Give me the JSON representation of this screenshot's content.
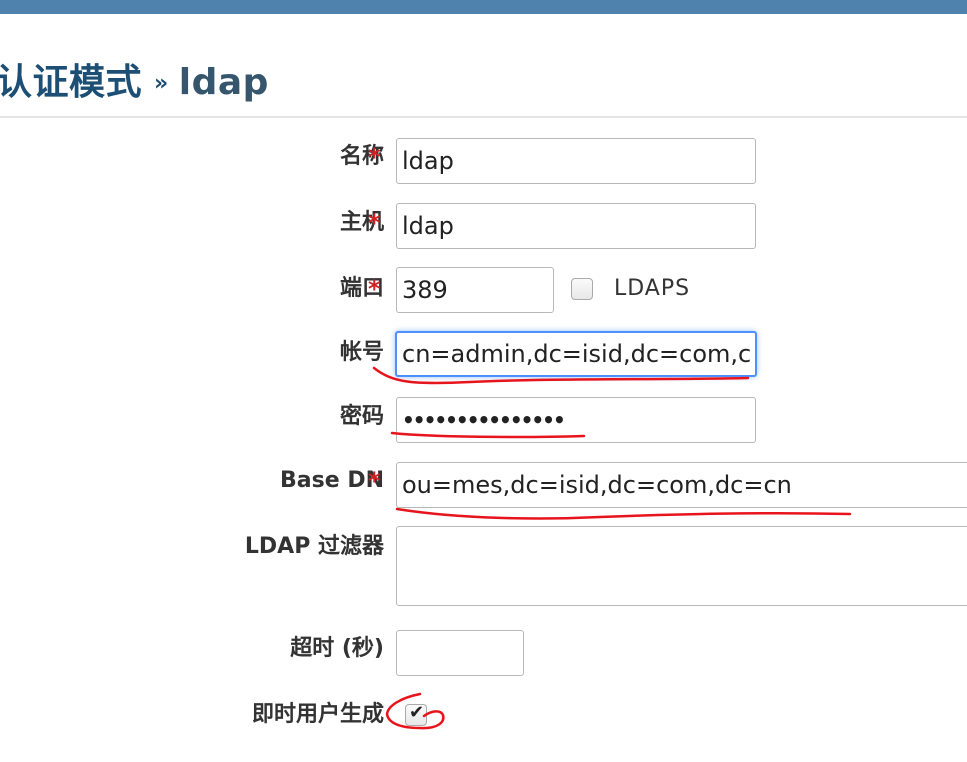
{
  "header": {
    "title": "认证模式",
    "separator": "»",
    "subtitle": "ldap"
  },
  "form": {
    "name": {
      "label": "名称",
      "required": "*",
      "value": "ldap"
    },
    "host": {
      "label": "主机",
      "required": "*",
      "value": "ldap"
    },
    "port": {
      "label": "端口",
      "required": "*",
      "value": "389",
      "ldaps_label": "LDAPS",
      "ldaps_checked": false
    },
    "account": {
      "label": "帐号",
      "value": "cn=admin,dc=isid,dc=com,c"
    },
    "password": {
      "label": "密码",
      "value": "•••••••••••••••"
    },
    "base_dn": {
      "label": "Base DN",
      "required": "*",
      "value": "ou=mes,dc=isid,dc=com,dc=cn"
    },
    "ldap_filter": {
      "label": "LDAP 过滤器",
      "value": ""
    },
    "timeout": {
      "label": "超时 (秒)",
      "value": ""
    },
    "onthefly": {
      "label": "即时用户生成",
      "checked": true,
      "checkmark": "✔"
    }
  },
  "colors": {
    "topbar": "#4f83ad",
    "title": "#1d4f74",
    "required": "#cc2424",
    "annotation": "#e8141c",
    "focus": "#4d90fe"
  }
}
